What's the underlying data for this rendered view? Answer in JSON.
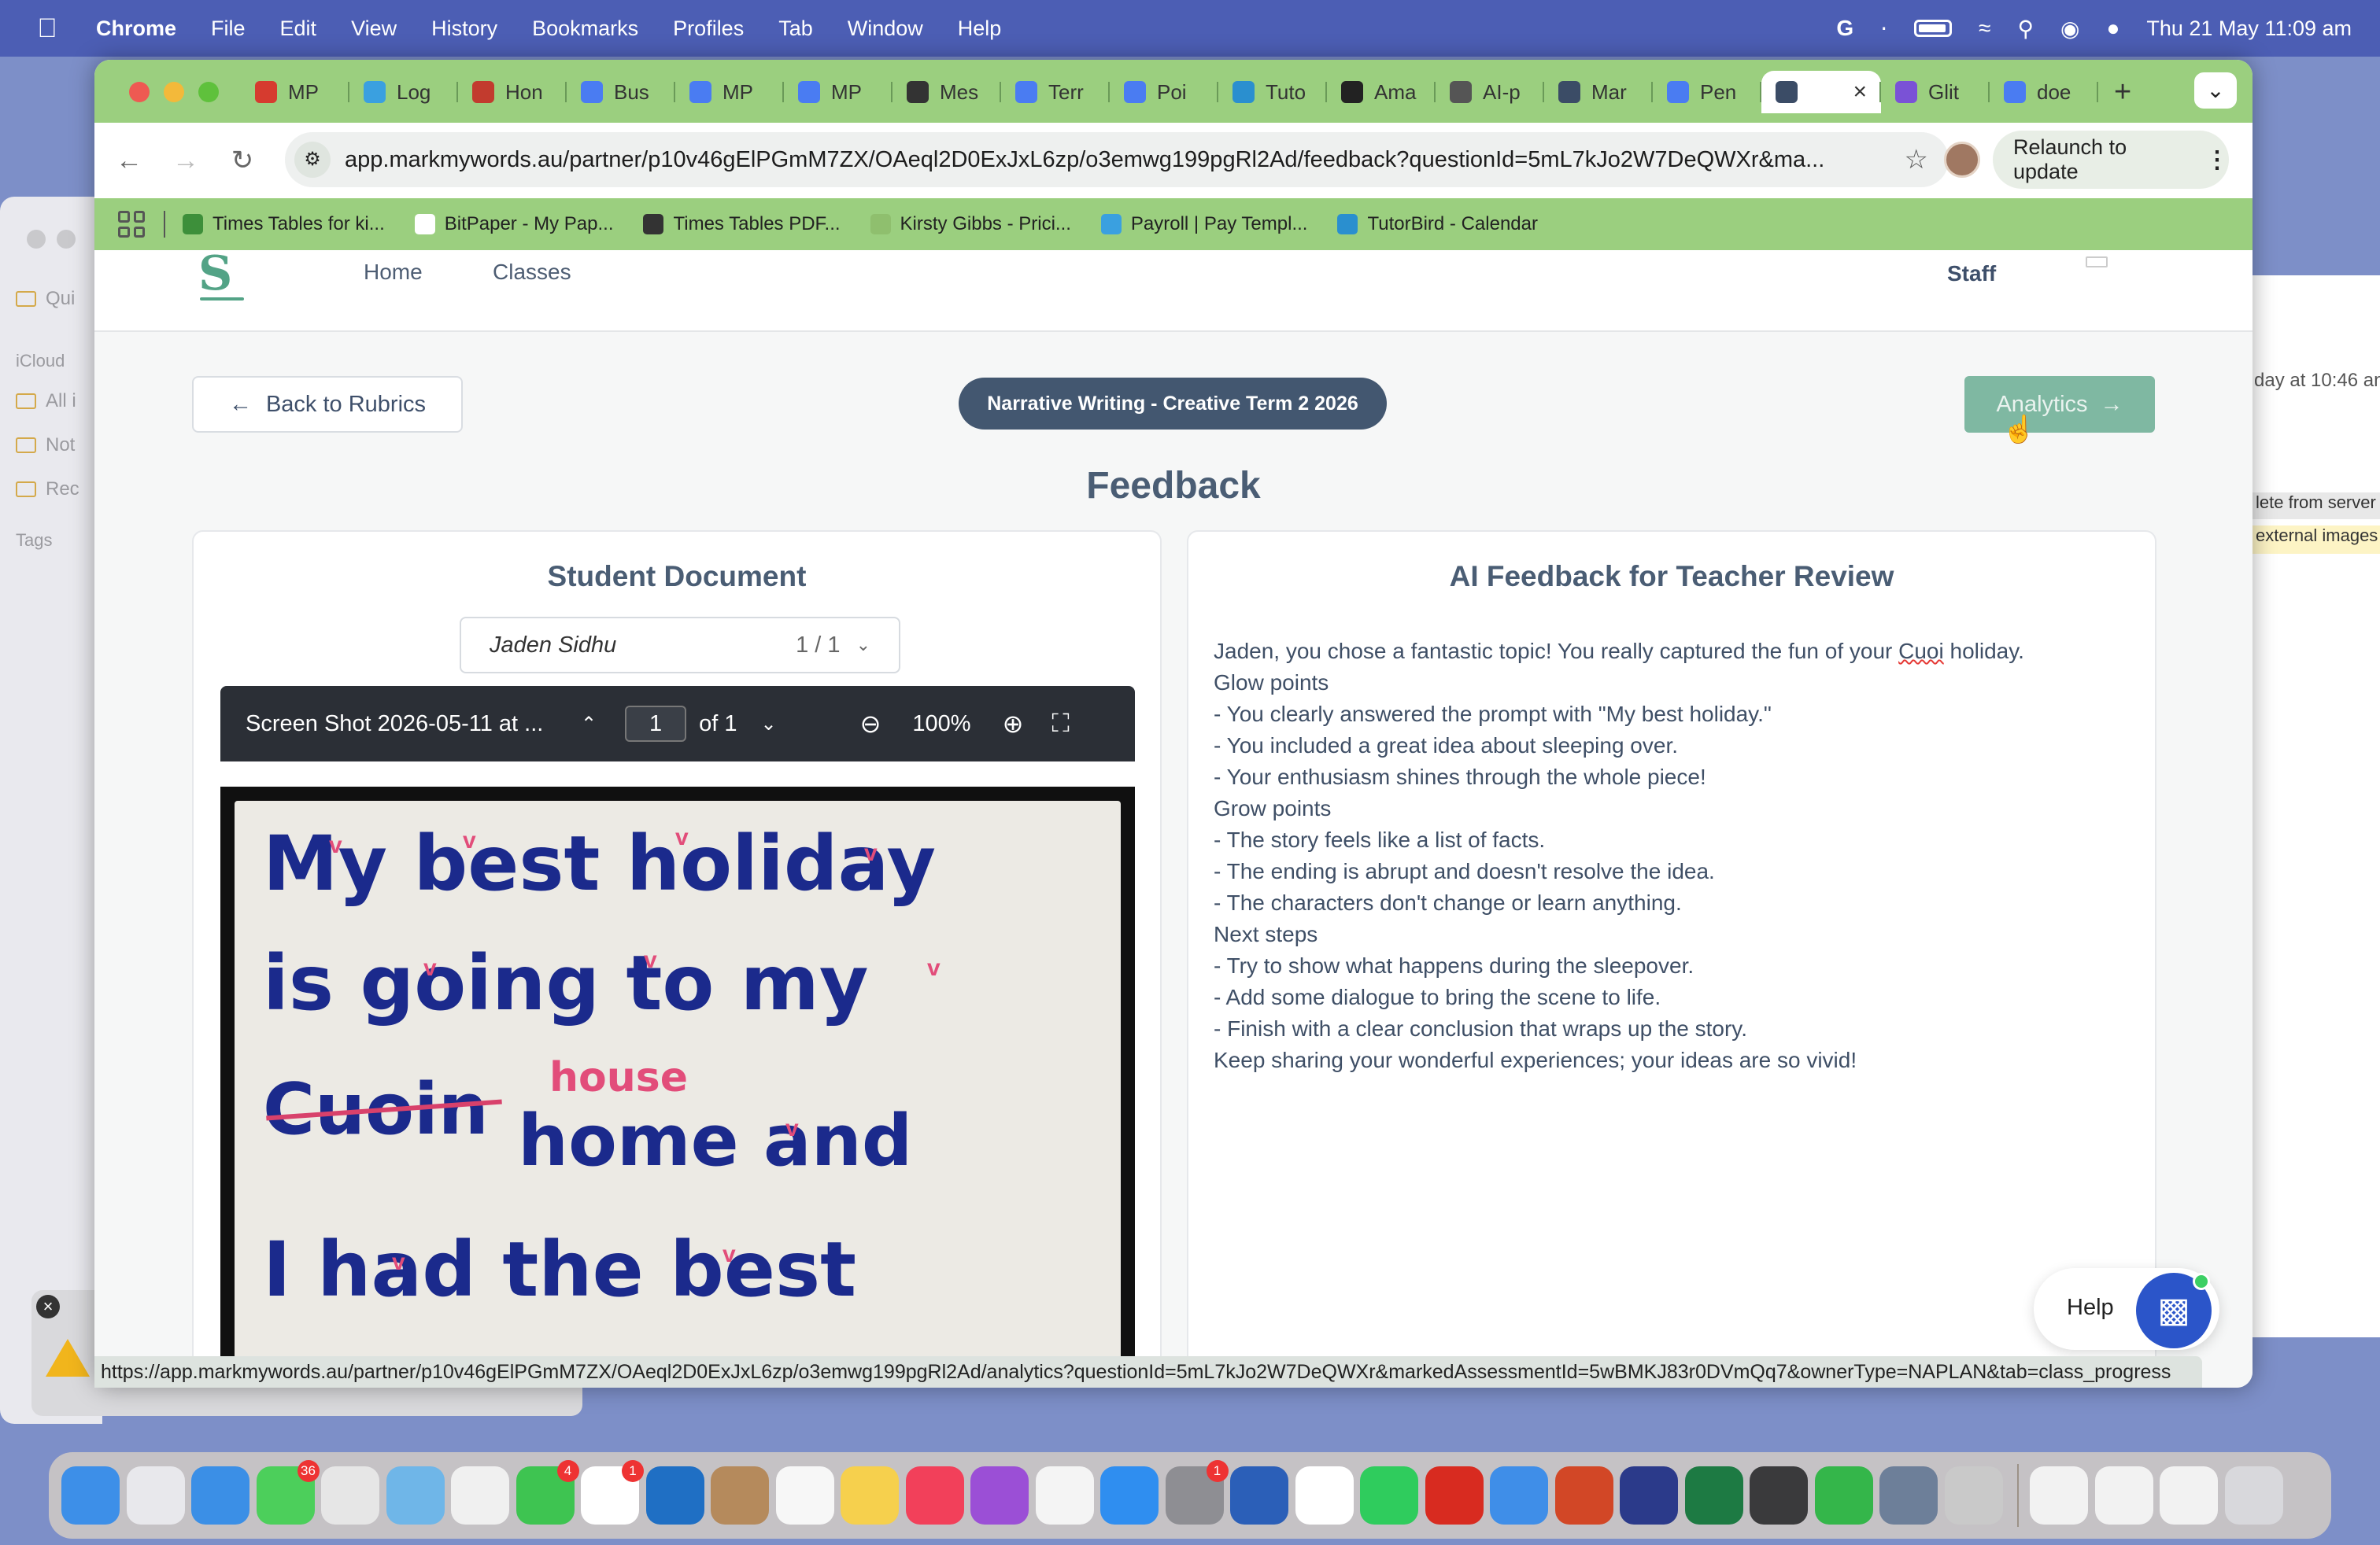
{
  "menubar": {
    "app_name": "Chrome",
    "items": [
      "File",
      "Edit",
      "View",
      "History",
      "Bookmarks",
      "Profiles",
      "Tab",
      "Window",
      "Help"
    ],
    "datetime": "Thu 21 May  11:09 am"
  },
  "background_windows": {
    "notes_sidebar": [
      "Qui",
      "iCloud",
      "All i",
      "Not",
      "Rec",
      "Tags"
    ],
    "right_window_lines": [
      "day at 10:46 an",
      "lete from server",
      "external images"
    ]
  },
  "chrome": {
    "tabs": [
      {
        "label": "MP",
        "color": "#d63b2f"
      },
      {
        "label": "Log",
        "color": "#3aa0e0"
      },
      {
        "label": "Hon",
        "color": "#c23b2e"
      },
      {
        "label": "Bus",
        "color": "#4a7cf2"
      },
      {
        "label": "MP",
        "color": "#4a7cf2"
      },
      {
        "label": "MP",
        "color": "#4a7cf2"
      },
      {
        "label": "Mes",
        "color": "#333333"
      },
      {
        "label": "Terr",
        "color": "#4a7cf2"
      },
      {
        "label": "Poi",
        "color": "#4a7cf2"
      },
      {
        "label": "Tuto",
        "color": "#2a8fcf"
      },
      {
        "label": "Ama",
        "color": "#222222"
      },
      {
        "label": "AI-p",
        "color": "#555555"
      },
      {
        "label": "Mar",
        "color": "#3b4c66"
      },
      {
        "label": "Pen",
        "color": "#4a7cf2"
      },
      {
        "label": "",
        "color": "#3b4c66"
      },
      {
        "label": "Glit",
        "color": "#7a52d6"
      },
      {
        "label": "doe",
        "color": "#4a7cf2"
      }
    ],
    "url": "app.markmywords.au/partner/p10v46gElPGmM7ZX/OAeql2D0ExJxL6zp/o3emwg199pgRl2Ad/feedback?questionId=5mL7kJo2W7DeQWXr&ma...",
    "relaunch_label": "Relaunch to update",
    "bookmarks": [
      {
        "label": "Times Tables for ki...",
        "color": "#3d8f3a"
      },
      {
        "label": "BitPaper - My Pap...",
        "color": "#ffffff"
      },
      {
        "label": "Times Tables PDF...",
        "color": "#333333"
      },
      {
        "label": "Kirsty Gibbs - Prici...",
        "color": "#8fbf6e"
      },
      {
        "label": "Payroll | Pay Templ...",
        "color": "#3aa0e0"
      },
      {
        "label": "TutorBird - Calendar",
        "color": "#2a8fcf"
      }
    ],
    "status_url": "https://app.markmywords.au/partner/p10v46gElPGmM7ZX/OAeql2D0ExJxL6zp/o3emwg199pgRl2Ad/analytics?questionId=5mL7kJo2W7DeQWXr&markedAssessmentId=5wBMKJ83r0DVmQq7&ownerType=NAPLAN&tab=class_progress"
  },
  "page": {
    "logo": "S",
    "nav": {
      "home": "Home",
      "classes": "Classes",
      "staff": "Staff"
    },
    "back_label": "Back to Rubrics",
    "rubric_pill": "Narrative Writing - Creative Term 2 2026",
    "analytics_label": "Analytics",
    "title": "Feedback",
    "student_document": {
      "title": "Student Document",
      "student_name": "Jaden Sidhu",
      "student_count": "1 / 1",
      "pdf": {
        "filename": "Screen Shot 2026-05-11 at ...",
        "page": "1",
        "of_pages": "of 1",
        "zoom": "100%"
      },
      "handwriting": {
        "line1": "My best holiday",
        "line2": "is going to my",
        "line3_struck": "Cuoin",
        "line3_insert": "house",
        "line3_rest": "home and",
        "line4": "I had the best"
      }
    },
    "ai_feedback": {
      "title": "AI Feedback for Teacher Review",
      "intro_before": "Jaden, you chose a fantastic topic! You really captured the fun of your ",
      "intro_flagged": "Cuoi",
      "intro_after": " holiday.",
      "glow_heading": "Glow points",
      "glow": [
        "- You clearly answered the prompt with \"My best holiday.\"",
        "- You included a great idea about sleeping over.",
        "- Your enthusiasm shines through the whole piece!"
      ],
      "grow_heading": "Grow points",
      "grow": [
        "- The story feels like a list of facts.",
        "- The ending is abrupt and doesn't resolve the idea.",
        "- The characters don't change or learn anything."
      ],
      "next_heading": "Next steps",
      "next": [
        "- Try to show what happens during the sleepover.",
        "- Add some dialogue to bring the scene to life.",
        "- Finish with a clear conclusion that wraps up the story."
      ],
      "closing": "Keep sharing your wonderful experiences; your ideas are so vivid!"
    },
    "help_label": "Help"
  },
  "dock": {
    "apps": [
      {
        "name": "finder",
        "color": "#3d8fe8"
      },
      {
        "name": "launchpad",
        "color": "#e8e8ec"
      },
      {
        "name": "safari",
        "color": "#3b8fe6"
      },
      {
        "name": "messages",
        "color": "#4ccf5b",
        "badge": "36"
      },
      {
        "name": "chrome",
        "color": "#e6e6e6"
      },
      {
        "name": "maps",
        "color": "#6fb6e8"
      },
      {
        "name": "photos",
        "color": "#f0f0f0"
      },
      {
        "name": "facetime",
        "color": "#3ec451",
        "badge": "4"
      },
      {
        "name": "calendar",
        "color": "#ffffff",
        "badge": "1"
      },
      {
        "name": "outlook",
        "color": "#1f6fc4"
      },
      {
        "name": "contacts",
        "color": "#b58a5c"
      },
      {
        "name": "reminders",
        "color": "#f7f7f7"
      },
      {
        "name": "notes",
        "color": "#f6d04d"
      },
      {
        "name": "music",
        "color": "#f2405a"
      },
      {
        "name": "podcasts",
        "color": "#9b4fd6"
      },
      {
        "name": "news",
        "color": "#f4f4f4"
      },
      {
        "name": "app-store",
        "color": "#2f8ef0"
      },
      {
        "name": "system-settings",
        "color": "#8e8e93",
        "badge": "1"
      },
      {
        "name": "word",
        "color": "#2b5fb8"
      },
      {
        "name": "google-calendar",
        "color": "#ffffff"
      },
      {
        "name": "whatsapp",
        "color": "#2fcc5d"
      },
      {
        "name": "acrobat",
        "color": "#d82b20"
      },
      {
        "name": "mail",
        "color": "#3f8ee8"
      },
      {
        "name": "powerpoint",
        "color": "#d24726"
      },
      {
        "name": "grammarly",
        "color": "#2b3a8a"
      },
      {
        "name": "excel",
        "color": "#1d7a43"
      },
      {
        "name": "fusion-app",
        "color": "#3a3a3c"
      },
      {
        "name": "numbers",
        "color": "#34b64a"
      },
      {
        "name": "preview",
        "color": "#6d7f99"
      },
      {
        "name": "printer",
        "color": "#c9c9c9"
      }
    ],
    "recents": [
      {
        "name": "recent-window-1",
        "color": "#f2f2f2"
      },
      {
        "name": "recent-window-2",
        "color": "#f2f2f2"
      },
      {
        "name": "recent-window-3",
        "color": "#f2f2f2"
      },
      {
        "name": "trash",
        "color": "#d8d8dc"
      }
    ]
  }
}
